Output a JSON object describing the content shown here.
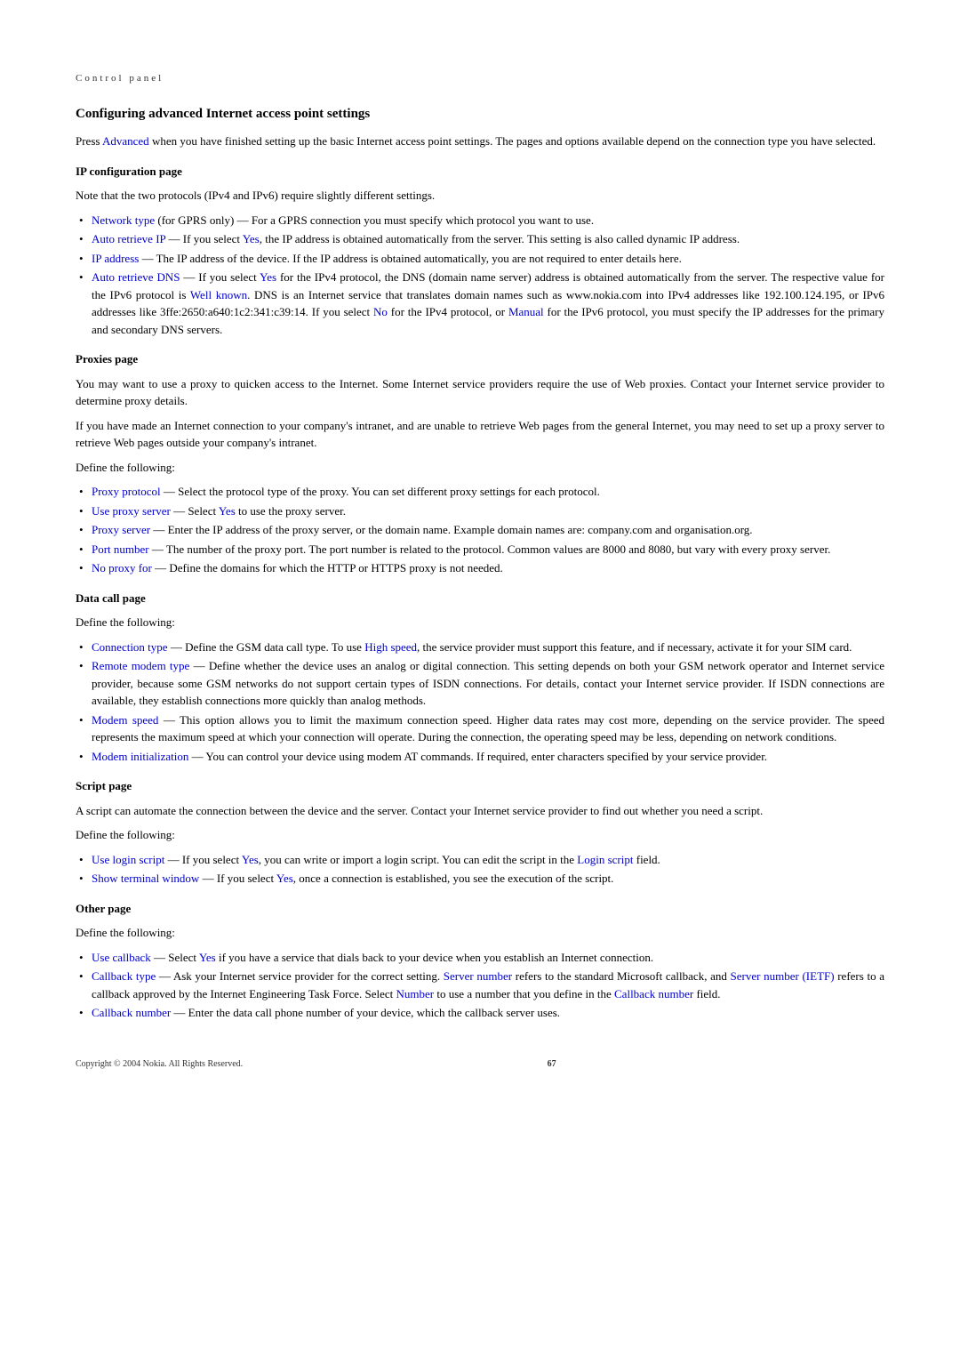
{
  "header": "Control panel",
  "title": "Configuring advanced Internet access point settings",
  "intro_p1_prefix": "Press ",
  "intro_p1_hl": "Advanced",
  "intro_p1_suffix": " when you have finished setting up the basic Internet access point settings. The pages and options available depend on the connection type you have selected.",
  "ip_config": {
    "heading": "IP configuration page",
    "note": "Note that the two protocols (IPv4 and IPv6) require slightly different settings.",
    "items": {
      "network_type_hl": "Network type",
      "network_type_text": " (for GPRS only) — For a GPRS connection you must specify which protocol you want to use.",
      "auto_ip_hl": "Auto retrieve IP",
      "auto_ip_text1": " — If you select ",
      "auto_ip_yes": "Yes",
      "auto_ip_text2": ", the IP address is obtained automatically from the server. This setting is also called dynamic IP address.",
      "ip_addr_hl": "IP address",
      "ip_addr_text": " — The IP address of the device. If the IP address is obtained automatically, you are not required to enter details here.",
      "auto_dns_hl": "Auto retrieve DNS",
      "auto_dns_text1": " — If you select ",
      "auto_dns_yes": "Yes",
      "auto_dns_text2": " for the IPv4 protocol, the DNS (domain name server) address is obtained automatically from the server. The respective value for the IPv6 protocol is ",
      "auto_dns_wellknown": "Well known",
      "auto_dns_text3": ". DNS is an Internet service that translates domain names such as www.nokia.com into IPv4 addresses like 192.100.124.195, or IPv6 addresses like 3ffe:2650:a640:1c2:341:c39:14. If you select ",
      "auto_dns_no": "No",
      "auto_dns_text4": " for the IPv4 protocol, or ",
      "auto_dns_manual": "Manual",
      "auto_dns_text5": " for the IPv6 protocol, you must specify the IP addresses for the primary and secondary DNS servers."
    }
  },
  "proxies": {
    "heading": "Proxies page",
    "p1": "You may want to use a proxy to quicken access to the Internet. Some Internet service providers require the use of Web proxies. Contact your Internet service provider to determine proxy details.",
    "p2": "If you have made an Internet connection to your company's intranet, and are unable to retrieve Web pages from the general Internet, you may need to set up a proxy server to retrieve Web pages outside your company's intranet.",
    "define": "Define the following:",
    "items": {
      "proxy_protocol_hl": "Proxy protocol",
      "proxy_protocol_text": " — Select the protocol type of the proxy. You can set different proxy settings for each protocol.",
      "use_proxy_hl": "Use proxy server",
      "use_proxy_text1": " — Select ",
      "use_proxy_yes": "Yes",
      "use_proxy_text2": " to use the proxy server.",
      "proxy_server_hl": "Proxy server",
      "proxy_server_text": " — Enter the IP address of the proxy server, or the domain name. Example domain names are: company.com and organisation.org.",
      "port_number_hl": "Port number",
      "port_number_text": " — The number of the proxy port. The port number is related to the protocol. Common values are 8000 and 8080, but vary with every proxy server.",
      "no_proxy_hl": "No proxy for",
      "no_proxy_text": " — Define the domains for which the HTTP or HTTPS proxy is not needed."
    }
  },
  "data_call": {
    "heading": "Data call page",
    "define": "Define the following:",
    "items": {
      "conn_type_hl": "Connection type",
      "conn_type_text1": " — Define the GSM data call type. To use ",
      "conn_type_highspeed": "High speed",
      "conn_type_text2": ", the service provider must support this feature, and if necessary, activate it for your SIM card.",
      "remote_modem_hl": "Remote modem type",
      "remote_modem_text": " — Define whether the device uses an analog or digital connection. This setting depends on both your GSM network operator and Internet service provider, because some GSM networks do not support certain types of ISDN connections. For details, contact your Internet service provider. If ISDN connections are available, they establish connections more quickly than analog methods.",
      "modem_speed_hl": "Modem speed",
      "modem_speed_text": " — This option allows you to limit the maximum connection speed. Higher data rates may cost more, depending on the service provider. The speed represents the maximum speed at which your connection will operate. During the connection, the operating speed may be less, depending on network conditions.",
      "modem_init_hl": "Modem initialization",
      "modem_init_text": " — You can control your device using modem AT commands. If required, enter characters specified by your service provider."
    }
  },
  "script": {
    "heading": "Script page",
    "p1": "A script can automate the connection between the device and the server. Contact your Internet service provider to find out whether you need a script.",
    "define": "Define the following:",
    "items": {
      "use_login_hl": "Use login script",
      "use_login_text1": " — If you select ",
      "use_login_yes": "Yes",
      "use_login_text2": ", you can write or import a login script. You can edit the script in the ",
      "use_login_field": "Login script",
      "use_login_text3": " field.",
      "show_terminal_hl": "Show terminal window",
      "show_terminal_text1": " — If you select ",
      "show_terminal_yes": "Yes",
      "show_terminal_text2": ", once a connection is established, you see the execution of the script."
    }
  },
  "other": {
    "heading": "Other page",
    "define": "Define the following:",
    "items": {
      "use_callback_hl": "Use callback",
      "use_callback_text1": " — Select ",
      "use_callback_yes": "Yes",
      "use_callback_text2": " if you have a service that dials back to your device when you establish an Internet connection.",
      "callback_type_hl": "Callback type",
      "callback_type_text1": " — Ask your Internet service provider for the correct setting. ",
      "callback_type_server": "Server number",
      "callback_type_text2": " refers to the standard Microsoft callback, and ",
      "callback_type_ietf": "Server number (IETF)",
      "callback_type_text3": " refers to a callback approved by the Internet Engineering Task Force. Select ",
      "callback_type_number": "Number",
      "callback_type_text4": " to use a number that you define in the ",
      "callback_type_field": "Callback number",
      "callback_type_text5": " field.",
      "callback_number_hl": "Callback number",
      "callback_number_text": " — Enter the data call phone number of your device, which the callback server uses."
    }
  },
  "footer": {
    "copyright": "Copyright © 2004 Nokia. All Rights Reserved.",
    "page": "67"
  }
}
